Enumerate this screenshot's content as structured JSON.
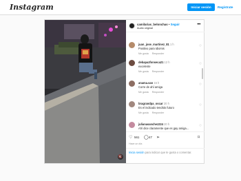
{
  "topbar": {
    "logo": "Instagram",
    "login_button": "Iniciar sesión",
    "signup_link": "Regístrate"
  },
  "post": {
    "username": "camilarias_belonchas",
    "separator": " • ",
    "follow": "Seguir",
    "audio": "Audio original",
    "comments": [
      {
        "user": "juan_jose_martinez_81",
        "time": "1 h",
        "text": "Positivo para Idiomis",
        "likes": "Me gusta",
        "reply": "Responder",
        "avatar_color": "#b58b6a"
      },
      {
        "user": "debapazfonseca21",
        "time": "12 h",
        "text": "excelente",
        "likes": "Me gusta",
        "reply": "Responder",
        "avatar_color": "#6d4c41"
      },
      {
        "user": "anama.san",
        "time": "15 h",
        "text": "Corre de ahí amiga",
        "likes": "Me gusta",
        "reply": "Responder",
        "avatar_color": "#8d6e63"
      },
      {
        "user": "bragrandpa_oscar",
        "time": "20 h",
        "text": "Es el indicado tendrás futuro",
        "likes": "Me gusta",
        "reply": "Responder",
        "avatar_color": "#a1887f"
      },
      {
        "user": "julianasanchez224",
        "time": "20 h",
        "text": "Ahí dice claramente que es gay amiga...",
        "likes": "",
        "reply": "",
        "avatar_color": "#c48b9f"
      }
    ],
    "likes_count": "561",
    "comments_count": "47",
    "date": "Hace un día",
    "login_prompt_link": "Inicia sesión",
    "login_prompt_rest": " para indicar que te gusta o comentar."
  },
  "icons": {
    "heart": "heart-icon",
    "comment": "comment-icon",
    "share": "share-icon",
    "save": "bookmark-icon",
    "more": "more-icon",
    "mute": "mute-icon"
  }
}
